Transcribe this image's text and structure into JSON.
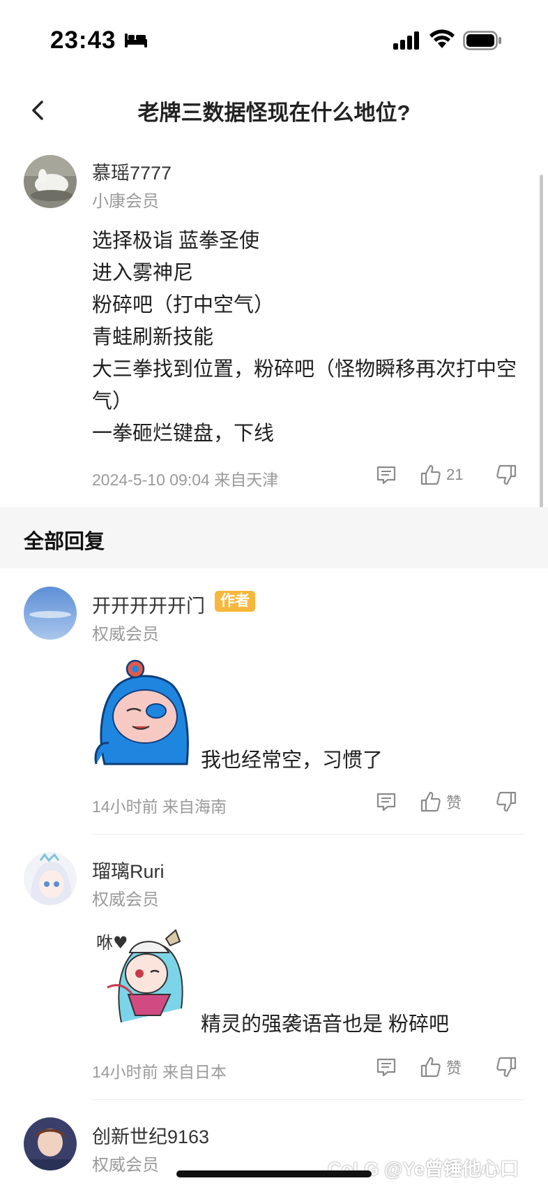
{
  "status_bar": {
    "time": "23:43"
  },
  "nav": {
    "title": "老牌三数据怪现在什么地位?"
  },
  "main_post": {
    "username": "慕瑶7777",
    "member_level": "小康会员",
    "lines": [
      "选择极诣 蓝拳圣使",
      "进入雾神尼",
      "粉碎吧（打中空气）",
      "青蛙刷新技能",
      "大三拳找到位置，粉碎吧（怪物瞬移再次打中空",
      "气）",
      "一拳砸烂键盘，下线"
    ],
    "meta": "2024-5-10 09:04 来自天津",
    "likes": "21"
  },
  "replies_header": "全部回复",
  "replies": [
    {
      "username": "开开开开开门",
      "badge": "作者",
      "member_level": "权威会员",
      "text": "我也经常空，习惯了",
      "meta": "14小时前 来自海南",
      "like_label": "赞"
    },
    {
      "username": "瑠璃Ruri",
      "member_level": "权威会员",
      "text": "精灵的强袭语音也是 粉碎吧",
      "meta": "14小时前 来自日本",
      "like_label": "赞",
      "sticker_text": "咻♥"
    },
    {
      "username": "创新世纪9163",
      "member_level": "权威会员"
    }
  ],
  "watermark": "CoLG @Ye曾锤他心口",
  "colors": {
    "author_badge": "#f6b73c",
    "section_bg": "#f6f6f6",
    "meta_gray": "#9a9a9a"
  }
}
